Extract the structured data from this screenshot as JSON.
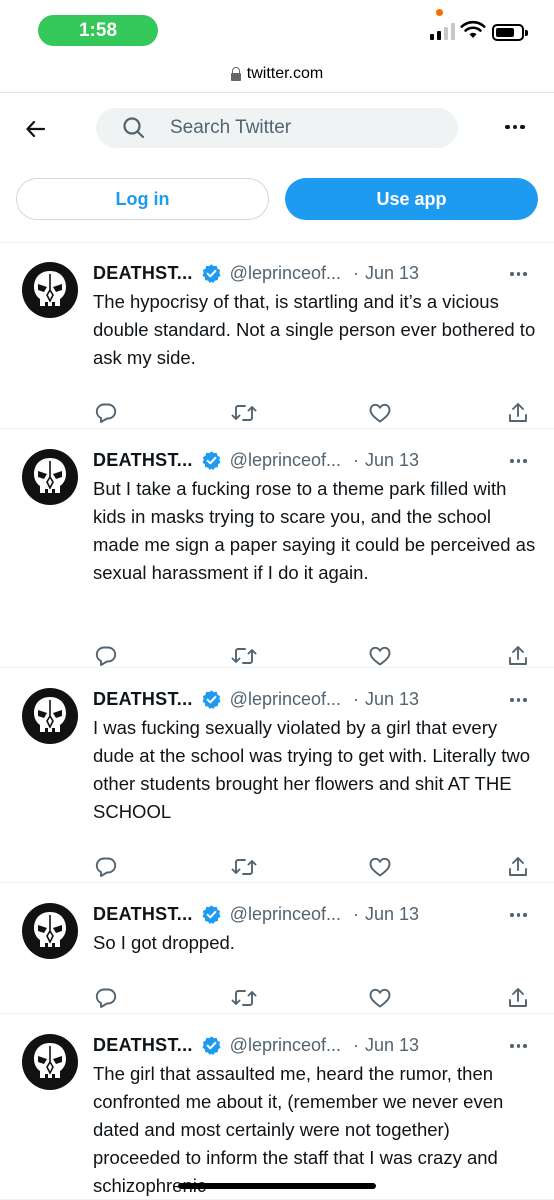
{
  "status_bar": {
    "time": "1:58"
  },
  "browser": {
    "url": "twitter.com"
  },
  "header": {
    "search_placeholder": "Search Twitter"
  },
  "auth": {
    "login_label": "Log in",
    "app_label": "Use app"
  },
  "icons": {
    "back": "arrow-left-icon",
    "search": "search-icon",
    "more": "more-horizontal-icon",
    "verified": "verified-badge-icon",
    "reply": "reply-icon",
    "retweet": "retweet-icon",
    "like": "heart-icon",
    "share": "share-icon"
  },
  "colors": {
    "accent": "#1d9bf0",
    "text": "#0f1419",
    "muted": "#536471",
    "status_pill": "#34c759"
  },
  "tweets": [
    {
      "name": "DEATHST...",
      "handle": "@leprinceof...",
      "sep": "·",
      "date": "Jun 13",
      "text": "The hypocrisy of that, is startling and it’s a vicious double standard. Not a single person ever bothered to ask my side."
    },
    {
      "name": "DEATHST...",
      "handle": "@leprinceof...",
      "sep": "·",
      "date": "Jun 13",
      "text": "But I take a fucking rose to a theme park filled with kids in masks trying to scare you, and the school made me sign a paper saying it could be perceived as sexual harassment if I do it again."
    },
    {
      "name": "DEATHST...",
      "handle": "@leprinceof...",
      "sep": "·",
      "date": "Jun 13",
      "text": "I was fucking sexually violated by a girl that every dude at the school was trying to get with. Literally two other students brought her flowers and shit AT THE SCHOOL"
    },
    {
      "name": "DEATHST...",
      "handle": "@leprinceof...",
      "sep": "·",
      "date": "Jun 13",
      "text": "So I got dropped."
    },
    {
      "name": "DEATHST...",
      "handle": "@leprinceof...",
      "sep": "·",
      "date": "Jun 13",
      "text": "The girl that assaulted me, heard the rumor, then confronted me about it, (remember we never even dated and most certainly were not together) proceeded to inform the staff that I was crazy and schizophrenic"
    }
  ]
}
